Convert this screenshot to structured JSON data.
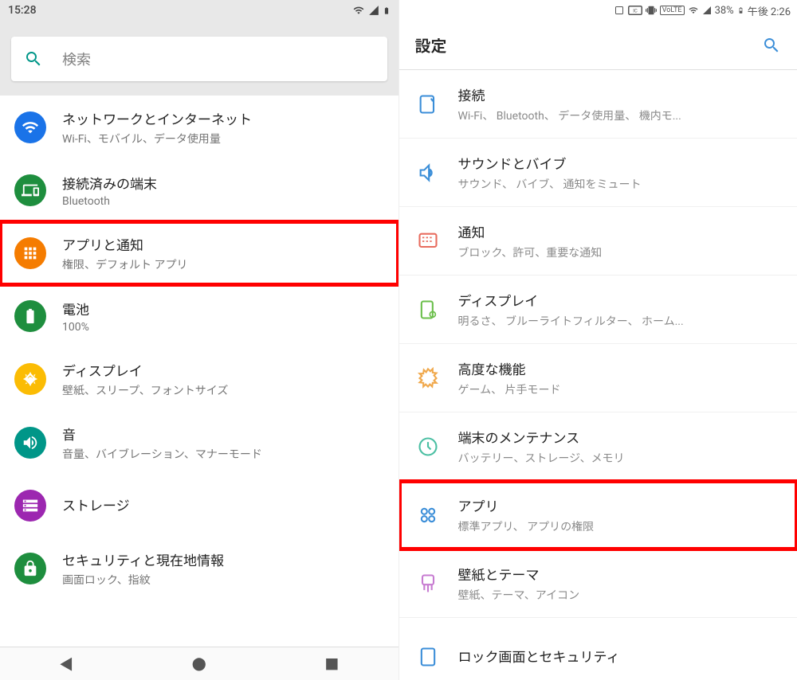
{
  "left": {
    "status": {
      "time": "15:28"
    },
    "search": {
      "placeholder": "検索"
    },
    "items": [
      {
        "title": "ネットワークとインターネット",
        "sub": "Wi-Fi、モバイル、データ使用量",
        "icon": "wifi-icon",
        "color": "#1a73e8"
      },
      {
        "title": "接続済みの端末",
        "sub": "Bluetooth",
        "icon": "devices-icon",
        "color": "#1e8e3e"
      },
      {
        "title": "アプリと通知",
        "sub": "権限、デフォルト アプリ",
        "icon": "apps-icon",
        "color": "#f57c00",
        "highlight": true
      },
      {
        "title": "電池",
        "sub": "100%",
        "icon": "battery-icon",
        "color": "#1e8e3e"
      },
      {
        "title": "ディスプレイ",
        "sub": "壁紙、スリープ、フォントサイズ",
        "icon": "brightness-icon",
        "color": "#fbbc04"
      },
      {
        "title": "音",
        "sub": "音量、バイブレーション、マナーモード",
        "icon": "sound-icon",
        "color": "#009688"
      },
      {
        "title": "ストレージ",
        "sub": "",
        "icon": "storage-icon",
        "color": "#9c27b0"
      },
      {
        "title": "セキュリティと現在地情報",
        "sub": "画面ロック、指紋",
        "icon": "security-icon",
        "color": "#1e8e3e"
      }
    ]
  },
  "right": {
    "status": {
      "battery": "38%",
      "time": "午後 2:26"
    },
    "header": {
      "title": "設定"
    },
    "items": [
      {
        "title": "接続",
        "sub": "Wi-Fi、 Bluetooth、 データ使用量、 機内モ...",
        "icon": "connections-icon",
        "color": "#3b8ed8"
      },
      {
        "title": "サウンドとバイブ",
        "sub": "サウンド、 バイブ、 通知をミュート",
        "icon": "sound-icon",
        "color": "#3b8ed8"
      },
      {
        "title": "通知",
        "sub": "ブロック、許可、重要な通知",
        "icon": "notification-icon",
        "color": "#e86c5e"
      },
      {
        "title": "ディスプレイ",
        "sub": "明るさ、 ブルーライトフィルター、 ホーム...",
        "icon": "display-icon",
        "color": "#6bbf4b"
      },
      {
        "title": "高度な機能",
        "sub": "ゲーム、 片手モード",
        "icon": "advanced-icon",
        "color": "#f0a84b"
      },
      {
        "title": "端末のメンテナンス",
        "sub": "バッテリー、ストレージ、メモリ",
        "icon": "maintenance-icon",
        "color": "#4bbfa3"
      },
      {
        "title": "アプリ",
        "sub": "標準アプリ、 アプリの権限",
        "icon": "apps-icon",
        "color": "#3b8ed8",
        "highlight": true
      },
      {
        "title": "壁紙とテーマ",
        "sub": "壁紙、テーマ、アイコン",
        "icon": "wallpaper-icon",
        "color": "#c77bd1"
      },
      {
        "title": "ロック画面とセキュリティ",
        "sub": "",
        "icon": "lock-icon",
        "color": "#3b8ed8"
      }
    ]
  }
}
